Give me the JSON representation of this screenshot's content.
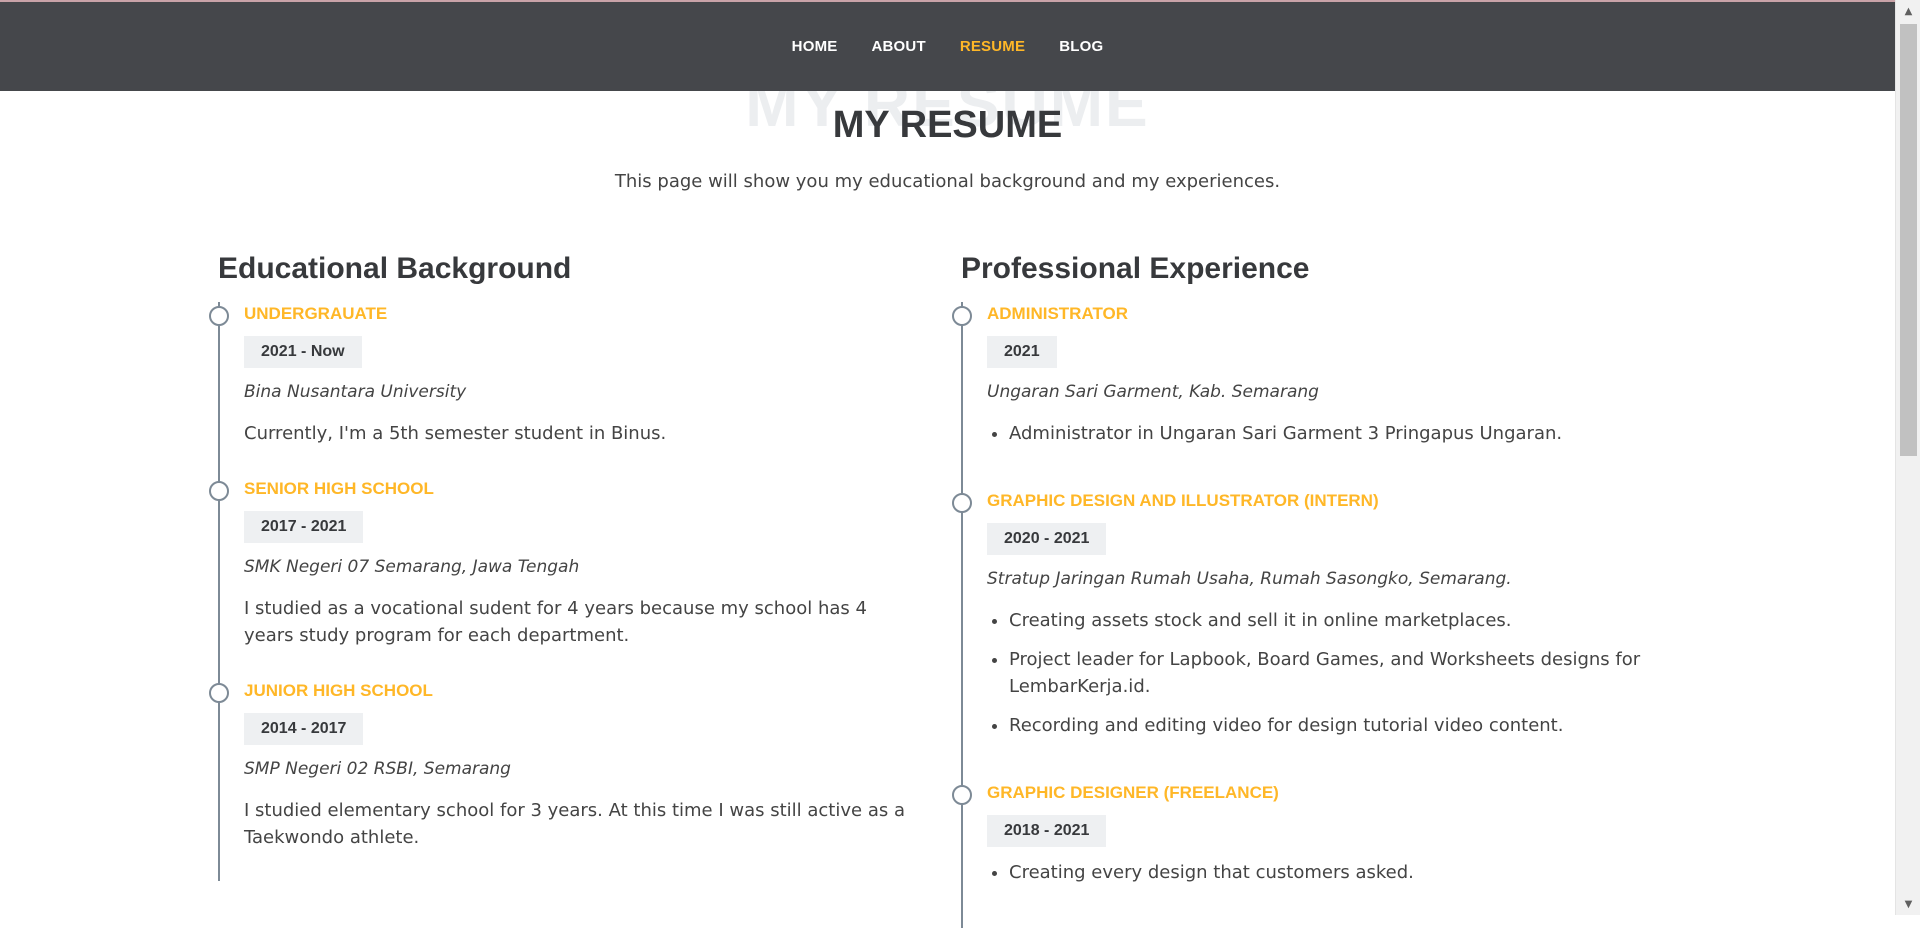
{
  "nav": {
    "items": [
      {
        "label": "HOME"
      },
      {
        "label": "ABOUT"
      },
      {
        "label": "RESUME",
        "active": true
      },
      {
        "label": "BLOG"
      }
    ]
  },
  "page": {
    "ghost_title": "MY RESUME",
    "title": "MY RESUME",
    "subtitle": "This page will show you my educational background and my experiences."
  },
  "education": {
    "heading": "Educational Background",
    "items": [
      {
        "title": "UNDERGRAUATE",
        "date": "2021 - Now",
        "org": "Bina Nusantara University",
        "desc": "Currently, I'm a 5th semester student in Binus."
      },
      {
        "title": "SENIOR HIGH SCHOOL",
        "date": "2017 - 2021",
        "org": "SMK Negeri 07 Semarang, Jawa Tengah",
        "desc": "I studied as a vocational sudent for 4 years because my school has 4 years study program for each department."
      },
      {
        "title": "JUNIOR HIGH SCHOOL",
        "date": "2014 - 2017",
        "org": "SMP Negeri 02 RSBI, Semarang",
        "desc": "I studied elementary school for 3 years. At this time I was still active as a Taekwondo athlete."
      }
    ]
  },
  "experience": {
    "heading": "Professional Experience",
    "items": [
      {
        "title": "ADMINISTRATOR",
        "date": "2021",
        "org": "Ungaran Sari Garment, Kab. Semarang",
        "bullets": [
          "Administrator in Ungaran Sari Garment 3 Pringapus Ungaran."
        ]
      },
      {
        "title": "GRAPHIC DESIGN AND ILLUSTRATOR (INTERN)",
        "date": "2020 - 2021",
        "org": "Stratup Jaringan Rumah Usaha, Rumah Sasongko, Semarang.",
        "bullets": [
          "Creating assets stock and sell it in online marketplaces.",
          "Project leader for Lapbook, Board Games, and Worksheets designs for LembarKerja.id.",
          "Recording and editing video for design tutorial video content."
        ]
      },
      {
        "title": "GRAPHIC DESIGNER (FREELANCE)",
        "date": "2018 - 2021",
        "org": "",
        "bullets": [
          "Creating every design that customers asked."
        ]
      }
    ]
  },
  "scrollbar": {
    "up_icon": "▲",
    "down_icon": "▼"
  }
}
